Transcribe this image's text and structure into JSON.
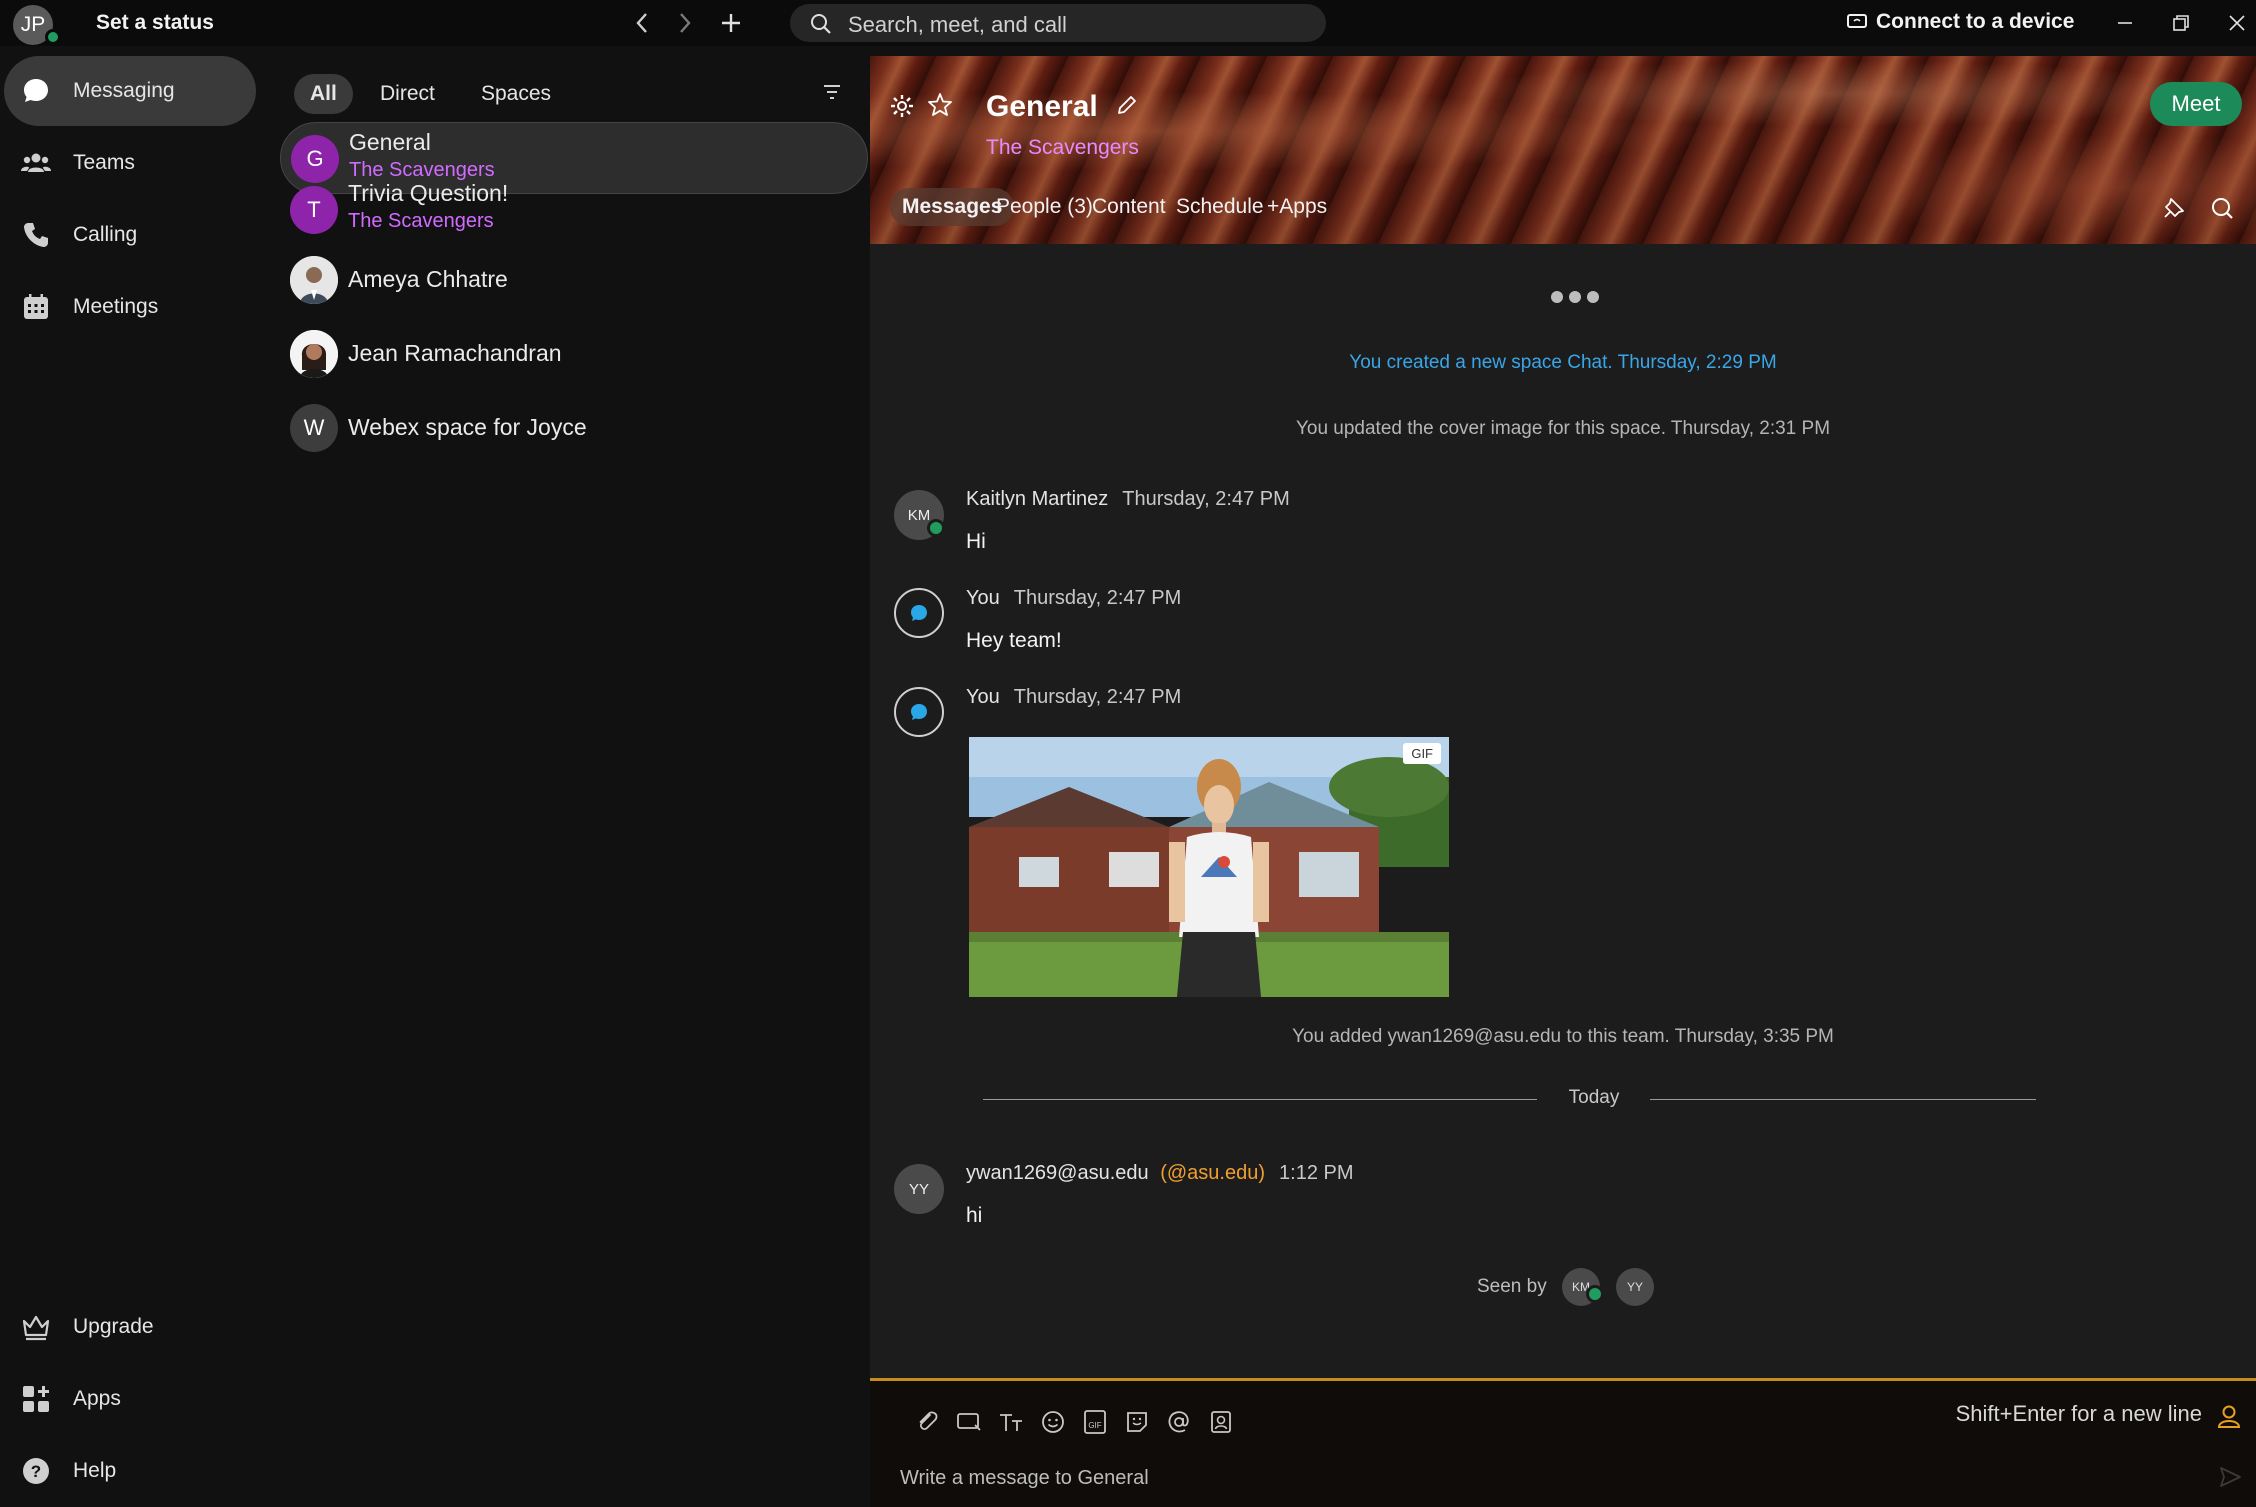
{
  "topbar": {
    "avatar_initials": "JP",
    "status_label": "Set a status",
    "search_placeholder": "Search, meet, and call",
    "connect_label": "Connect to a device"
  },
  "leftnav": {
    "items": [
      {
        "label": "Messaging",
        "icon": "chat-bubble-icon"
      },
      {
        "label": "Teams",
        "icon": "people-icon"
      },
      {
        "label": "Calling",
        "icon": "phone-icon"
      },
      {
        "label": "Meetings",
        "icon": "calendar-icon"
      }
    ],
    "bottom": [
      {
        "label": "Upgrade",
        "icon": "crown-icon"
      },
      {
        "label": "Apps",
        "icon": "apps-grid-icon"
      },
      {
        "label": "Help",
        "icon": "help-icon"
      }
    ]
  },
  "conversations": {
    "filters": [
      "All",
      "Direct",
      "Spaces"
    ],
    "items": [
      {
        "initial": "G",
        "name": "General",
        "sub": "The Scavengers",
        "color": "#8e24aa"
      },
      {
        "initial": "T",
        "name": "Trivia Question!",
        "sub": "The Scavengers",
        "color": "#8e24aa"
      },
      {
        "initial": "",
        "name": "Ameya Chhatre",
        "sub": ""
      },
      {
        "initial": "",
        "name": "Jean Ramachandran",
        "sub": ""
      },
      {
        "initial": "W",
        "name": "Webex space for Joyce",
        "sub": "",
        "color": "#3d3d3d"
      }
    ]
  },
  "space": {
    "title": "General",
    "team": "The Scavengers",
    "meet_label": "Meet",
    "tabs": [
      "Messages",
      "People (3)",
      "Content",
      "Schedule",
      "+Apps"
    ]
  },
  "messages": {
    "sys1": "You created a new space Chat. Thursday, 2:29 PM",
    "sys2": "You updated the cover image for this space. Thursday, 2:31 PM",
    "m1": {
      "initials": "KM",
      "sender": "Kaitlyn Martinez",
      "time": "Thursday, 2:47 PM",
      "text": "Hi"
    },
    "m2": {
      "sender": "You",
      "time": "Thursday, 2:47 PM",
      "text": "Hey team!"
    },
    "m3": {
      "sender": "You",
      "time": "Thursday, 2:47 PM",
      "gif_badge": "GIF"
    },
    "sys3": "You added ywan1269@asu.edu to this team. Thursday, 3:35 PM",
    "divider": "Today",
    "m4": {
      "initials": "YY",
      "sender": "ywan1269@asu.edu",
      "domain": "(@asu.edu)",
      "time": "1:12 PM",
      "text": "hi"
    },
    "seen_by_label": "Seen by",
    "seen_by": [
      "KM",
      "YY"
    ]
  },
  "composer": {
    "hint": "Shift+Enter for a new line",
    "placeholder": "Write a message to General"
  },
  "colors": {
    "accent_green": "#1d8a5a",
    "purple": "#8e24aa",
    "link_blue": "#3aa6e8",
    "composer_border": "#c78b1e"
  }
}
